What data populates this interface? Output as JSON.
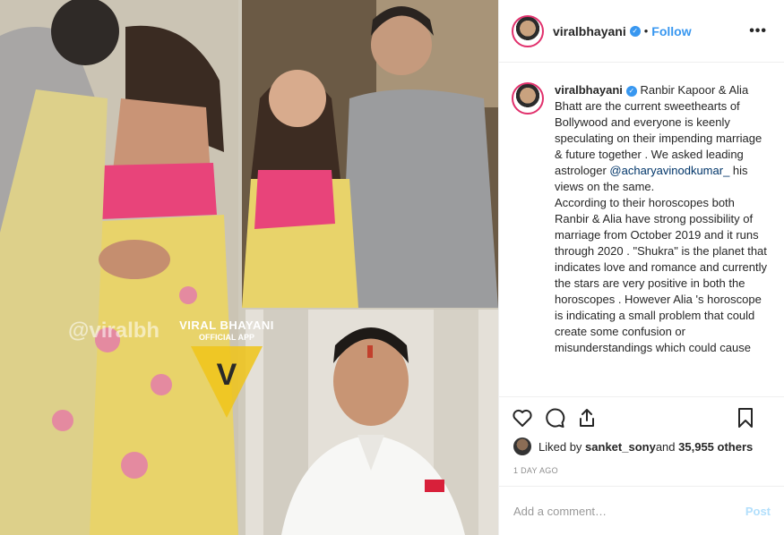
{
  "post": {
    "username": "viralbhayani",
    "follow_label": "Follow",
    "dot_separator": "•",
    "verified_glyph": "✓",
    "more_label": "•••"
  },
  "media": {
    "watermark_handle": "@viralbh",
    "watermark_title": "VIRAL BHAYANI",
    "watermark_subtitle": "OFFICIAL APP",
    "watermark_logo": "V"
  },
  "caption": {
    "username": "viralbhayani",
    "intro": " Ranbir Kapoor & Alia Bhatt are the current sweethearts of Bollywood and everyone is keenly speculating on their impending marriage & future together . We asked leading astrologer ",
    "mention": "@acharyavinodkumar_",
    "mention_tail": " his views on the same.",
    "body": "According to their horoscopes both Ranbir & Alia have strong possibility of marriage from October 2019 and it runs through 2020 . \"Shukra\" is the planet that indicates love and romance and currently the stars are very positive in both the horoscopes . However Alia 's horoscope is indicating a small problem that could create some confusion or misunderstandings which could cause"
  },
  "likes": {
    "prefix": "Liked by ",
    "user": "sanket_sony",
    "middle": " and ",
    "others": "35,955 others"
  },
  "timestamp": "1 DAY AGO",
  "comment": {
    "placeholder": "Add a comment…",
    "post_label": "Post"
  },
  "icons": {
    "like": "heart-icon",
    "comment": "speech-bubble-icon",
    "share": "share-icon",
    "save": "bookmark-icon"
  },
  "colors": {
    "accent": "#3897f0",
    "post_disabled": "#b2dffc",
    "saree_pink": "#e8447a",
    "saree_yellow": "#e8d36a"
  }
}
